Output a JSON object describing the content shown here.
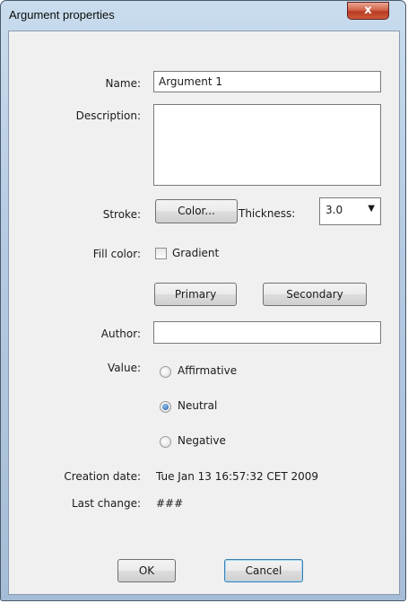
{
  "window": {
    "title": "Argument properties",
    "close_label": "x"
  },
  "form": {
    "name_label": "Name:",
    "name_value": "Argument 1",
    "description_label": "Description:",
    "description_value": "",
    "stroke_label": "Stroke:",
    "color_button": "Color...",
    "thickness_label": "Thickness:",
    "thickness_value": "3.0",
    "fill_color_label": "Fill color:",
    "gradient_label": "Gradient",
    "gradient_checked": false,
    "primary_button": "Primary",
    "secondary_button": "Secondary",
    "author_label": "Author:",
    "author_value": "",
    "value_label": "Value:",
    "value_options": [
      {
        "label": "Affirmative",
        "selected": false
      },
      {
        "label": "Neutral",
        "selected": true
      },
      {
        "label": "Negative",
        "selected": false
      }
    ],
    "creation_date_label": "Creation date:",
    "creation_date_value": "Tue Jan 13 16:57:32 CET 2009",
    "last_change_label": "Last change:",
    "last_change_value": "###"
  },
  "actions": {
    "ok_label": "OK",
    "cancel_label": "Cancel"
  },
  "icons": {
    "close": "close-icon",
    "dropdown": "chevron-down-icon"
  },
  "colors": {
    "frame": "#b5cbe2",
    "client": "#f0f0f0",
    "close_button": "#c8553b",
    "radio_selected": "#1d5fa6"
  }
}
